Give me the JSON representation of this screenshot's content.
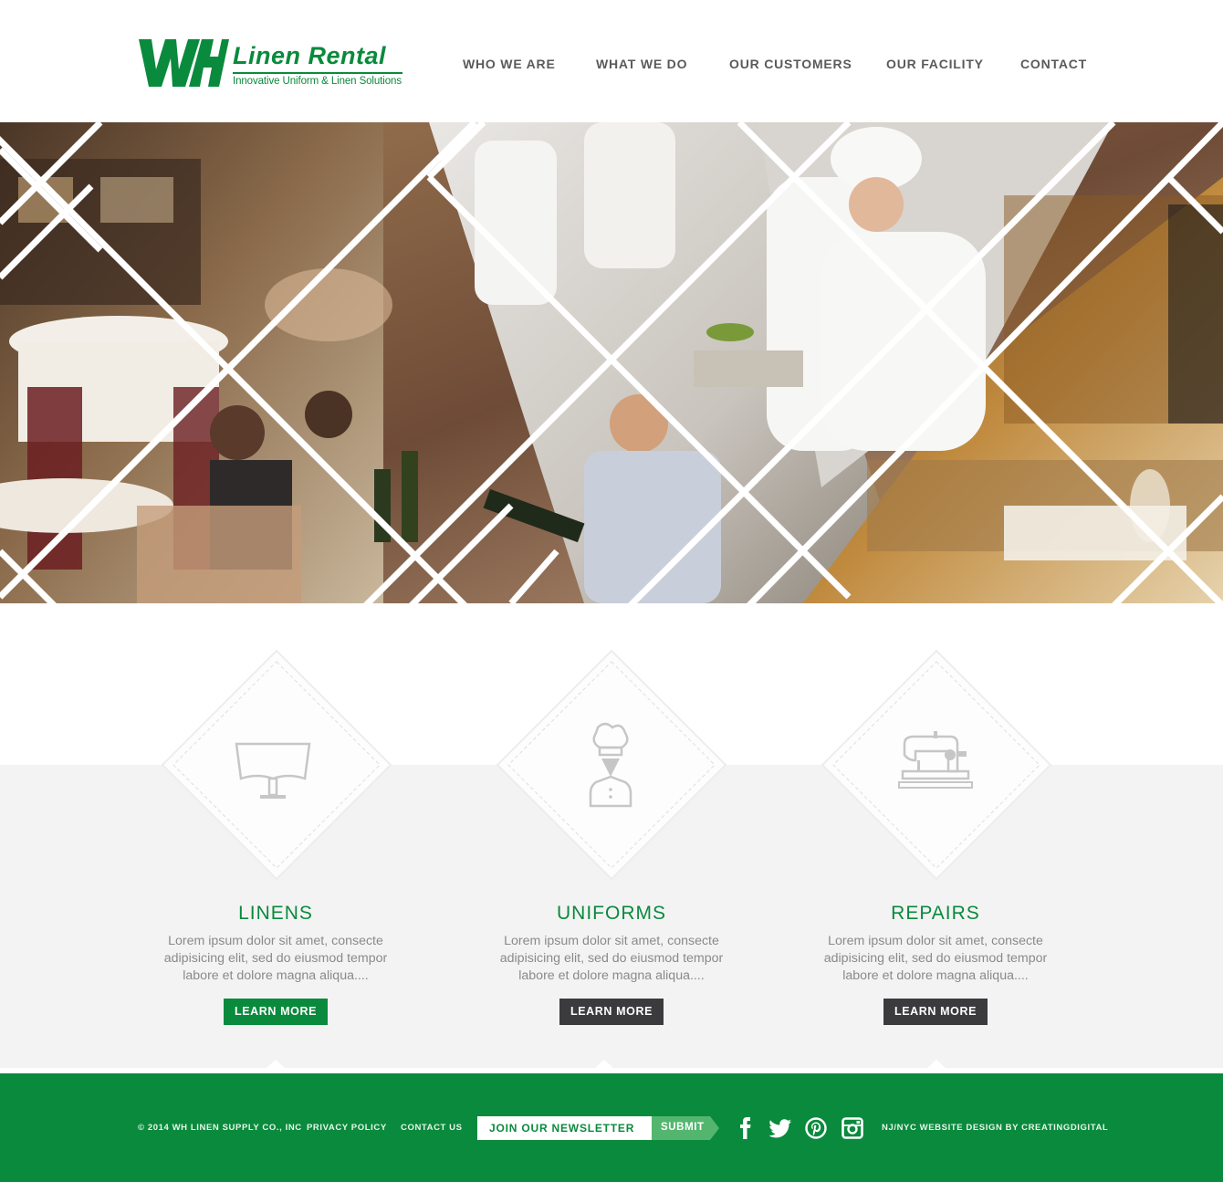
{
  "brand": {
    "logo_mark": "WH",
    "name": "Linen Rental",
    "tagline": "Innovative Uniform & Linen Solutions",
    "color": "#0a8a3c"
  },
  "nav": {
    "items": [
      {
        "label": "WHO WE ARE"
      },
      {
        "label": "WHAT WE DO"
      },
      {
        "label": "OUR CUSTOMERS"
      },
      {
        "label": "OUR FACILITY"
      },
      {
        "label": "CONTACT"
      }
    ]
  },
  "hero": {
    "image_description_icons": [
      "restaurant-dining-photo",
      "diners-photo",
      "chefs-kitchen-photo",
      "pouring-wine-photo",
      "chef-cutting-photo",
      "restaurant-bar-photo"
    ]
  },
  "services": [
    {
      "icon": "tablecloth-icon",
      "title": "LINENS",
      "description": "Lorem ipsum dolor sit amet, consecte adipisicing elit, sed do eiusmod tempor labore et dolore magna aliqua....",
      "button": "LEARN MORE",
      "button_style": "green"
    },
    {
      "icon": "chef-uniform-icon",
      "title": "UNIFORMS",
      "description": "Lorem ipsum dolor sit amet, consecte adipisicing elit, sed do eiusmod tempor labore et dolore magna aliqua....",
      "button": "LEARN MORE",
      "button_style": "dark"
    },
    {
      "icon": "sewing-machine-icon",
      "title": "REPAIRS",
      "description": "Lorem ipsum dolor sit amet, consecte adipisicing elit, sed do eiusmod tempor labore et dolore magna aliqua....",
      "button": "LEARN MORE",
      "button_style": "dark"
    }
  ],
  "footer": {
    "copyright": "© 2014 WH LINEN SUPPLY CO., INC",
    "privacy": "PRIVACY POLICY",
    "contact": "CONTACT US",
    "newsletter_placeholder": "JOIN OUR NEWSLETTER",
    "submit": "SUBMIT",
    "social": [
      "facebook-icon",
      "twitter-icon",
      "pinterest-icon",
      "instagram-icon"
    ],
    "credit": "NJ/NYC WEBSITE DESIGN BY CREATINGDIGITAL"
  },
  "colors": {
    "accent": "#0a8a3c",
    "dark_button": "#3b3b3d",
    "services_bg": "#f3f3f4"
  }
}
